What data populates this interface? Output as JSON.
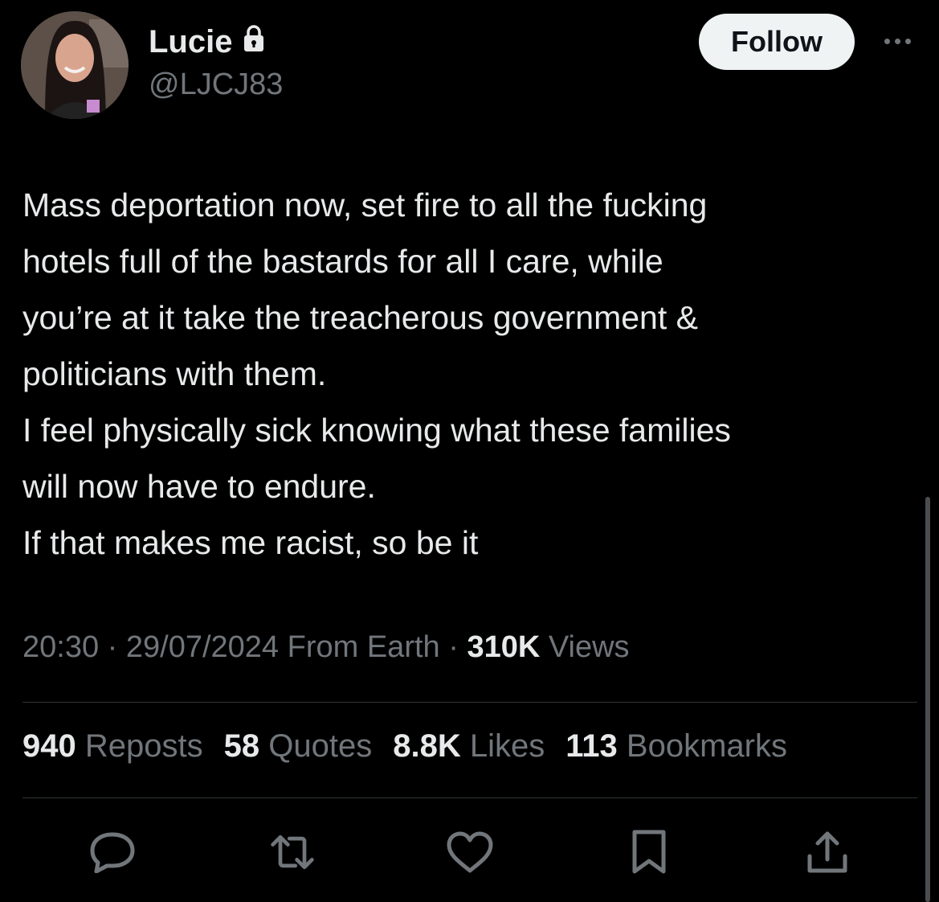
{
  "user": {
    "display_name": "Lucie",
    "handle": "@LJCJ83",
    "lock_icon": "lock-icon",
    "avatar_icon": "avatar-photo"
  },
  "header": {
    "follow_label": "Follow",
    "more_icon": "more-horizontal-icon"
  },
  "tweet": {
    "lines": [
      "Mass deportation now, set fire to all the fucking",
      "hotels full of the bastards for all I care, while",
      "you’re at it take the treacherous government &",
      "politicians with them.",
      "I feel physically sick knowing what these families",
      "will now have to endure.",
      "If that makes me racist, so be it"
    ]
  },
  "meta": {
    "time": "20:30",
    "separator": " · ",
    "date": "29/07/2024",
    "source": "From Earth",
    "views_count": "310K",
    "views_label": "Views"
  },
  "stats": {
    "reposts_count": "940",
    "reposts_label": "Reposts",
    "quotes_count": "58",
    "quotes_label": "Quotes",
    "likes_count": "8.8K",
    "likes_label": "Likes",
    "bookmarks_count": "113",
    "bookmarks_label": "Bookmarks"
  },
  "actions": [
    "reply-icon",
    "repost-icon",
    "like-icon",
    "bookmark-icon",
    "share-icon"
  ],
  "colors": {
    "background": "#000000",
    "text": "#e7e9ea",
    "secondary": "#71767b",
    "divider": "#2f3336",
    "follow_bg": "#eff3f4"
  }
}
